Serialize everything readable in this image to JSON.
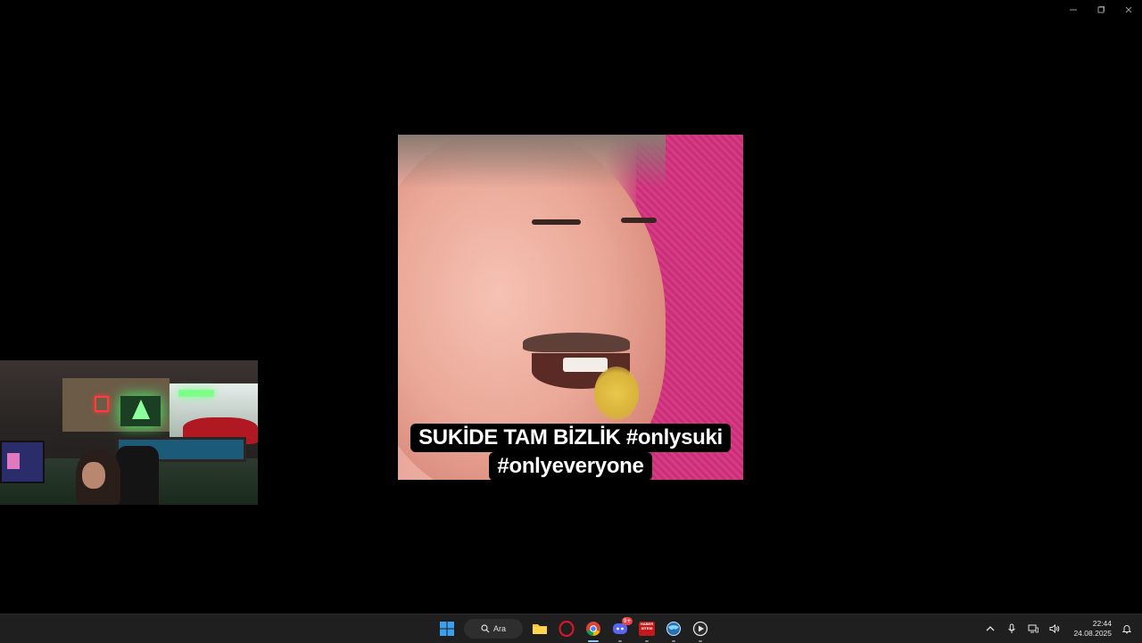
{
  "video": {
    "caption_line1": "SUKİDE TAM BİZLİK #onlysuki",
    "caption_line2": "#onlyeveryone"
  },
  "window_controls": {
    "minimize_icon": "minimize-icon",
    "restore_icon": "restore-icon",
    "close_icon": "close-icon"
  },
  "taskbar": {
    "search_label": "Ara",
    "apps": [
      {
        "name": "start-icon"
      },
      {
        "name": "file-explorer-icon"
      },
      {
        "name": "opera-icon"
      },
      {
        "name": "chrome-icon"
      },
      {
        "name": "discord-icon",
        "badge": "9+"
      },
      {
        "name": "news-app-icon",
        "text": "HABER SİTESİ"
      },
      {
        "name": "globe-app-icon"
      },
      {
        "name": "media-player-icon"
      }
    ],
    "tray": {
      "clock_time": "22:44",
      "clock_date": "24.08.2025"
    }
  },
  "colors": {
    "taskbar_bg": "#1f1f1f",
    "desktop_bg": "#000000",
    "accent": "#8fc8ff"
  }
}
